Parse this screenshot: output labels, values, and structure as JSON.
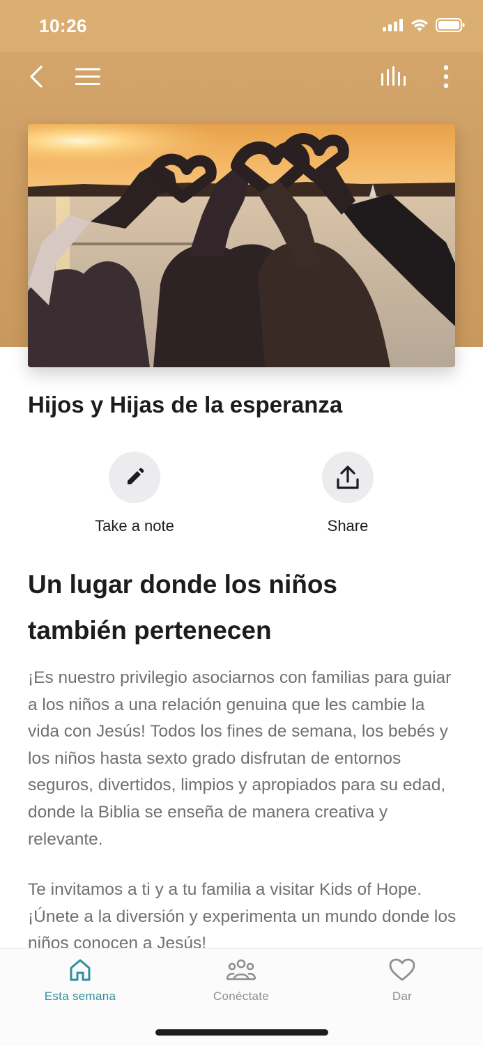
{
  "status": {
    "time": "10:26"
  },
  "nav": {
    "back_icon": "chevron-left-icon",
    "menu_icon": "hamburger-menu-icon",
    "audio_icon": "audio-bars-icon",
    "more_icon": "vertical-dots-icon"
  },
  "hero": {
    "image": "girls-making-heart-hands-at-sunset"
  },
  "page": {
    "title": "Hijos y Hijas de la esperanza"
  },
  "actions": {
    "note_label": "Take a note",
    "share_label": "Share"
  },
  "content": {
    "heading_line1": "Un lugar donde los niños",
    "heading_line2": "también pertenecen",
    "p1": "¡Es nuestro privilegio asociarnos con familias para guiar a los niños a una relación genuina que les cambie la vida con Jesús! Todos los fines de semana, los bebés y los niños hasta sexto grado disfrutan de entornos seguros, divertidos, limpios y apropiados para su edad, donde la Biblia se enseña de manera creativa y relevante.",
    "p2": "Te invitamos a ti y a tu familia a visitar Kids of Hope. ¡Únete a la diversión y experimenta un mundo donde los niños conocen a Jesús!"
  },
  "tabbar": {
    "tabs": [
      {
        "label": "Esta semana",
        "icon": "home-icon",
        "active": true
      },
      {
        "label": "Conéctate",
        "icon": "people-icon",
        "active": false
      },
      {
        "label": "Dar",
        "icon": "heart-icon",
        "active": false
      }
    ]
  },
  "colors": {
    "header": "#cfa066",
    "accent": "#2f8f9b",
    "body_text": "#707074"
  }
}
